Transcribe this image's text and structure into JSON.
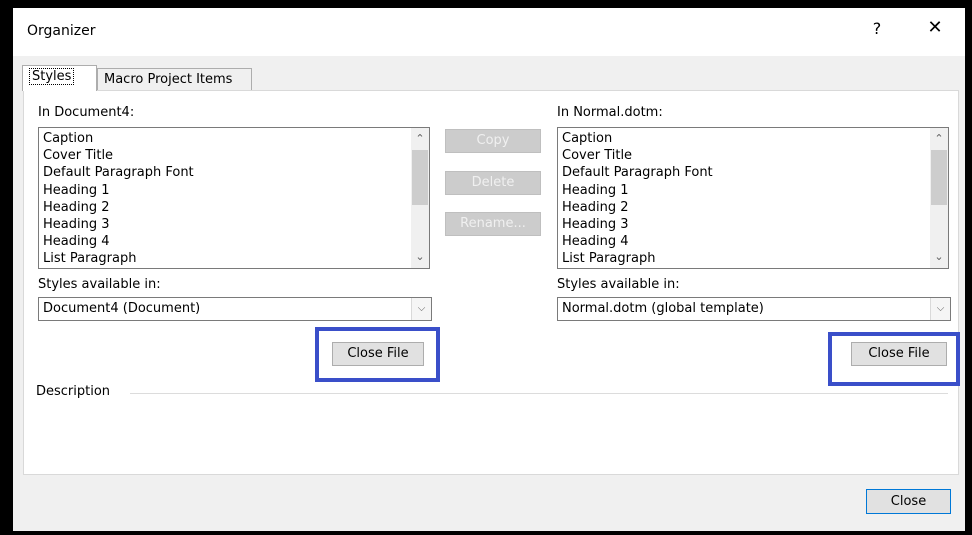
{
  "dialog": {
    "title": "Organizer",
    "help_glyph": "?",
    "close_glyph": "✕"
  },
  "tabs": [
    {
      "label": "Styles"
    },
    {
      "label": "Macro Project Items"
    }
  ],
  "left": {
    "header": "In Document4:",
    "items": [
      "Caption",
      "Cover Title",
      "Default Paragraph Font",
      "Heading 1",
      "Heading 2",
      "Heading 3",
      "Heading 4",
      "List Paragraph"
    ],
    "available_label": "Styles available in:",
    "available_value": "Document4 (Document)",
    "close_file": "Close File"
  },
  "right": {
    "header": "In Normal.dotm:",
    "items": [
      "Caption",
      "Cover Title",
      "Default Paragraph Font",
      "Heading 1",
      "Heading 2",
      "Heading 3",
      "Heading 4",
      "List Paragraph"
    ],
    "available_label": "Styles available in:",
    "available_value": "Normal.dotm (global template)",
    "close_file": "Close File"
  },
  "middle": {
    "copy": "Copy",
    "delete": "Delete",
    "rename": "Rename..."
  },
  "description_label": "Description",
  "footer": {
    "close": "Close"
  },
  "colors": {
    "highlight": "#3a4fc9"
  }
}
